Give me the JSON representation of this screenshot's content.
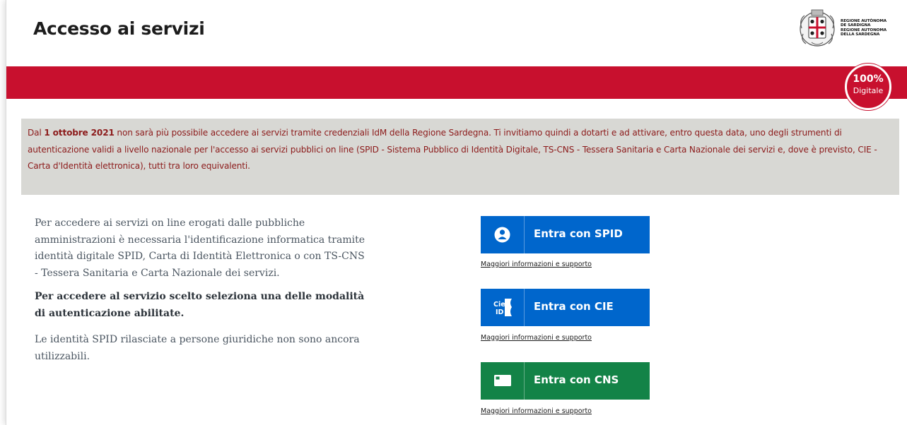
{
  "header": {
    "title": "Accesso ai servizi",
    "logo_lines": [
      "REGIONE AUTÒNOMA",
      "DE SARDIGNA",
      "REGIONE AUTONOMA",
      "DELLA SARDEGNA"
    ]
  },
  "badge": {
    "percent": "100%",
    "word": "Digitale"
  },
  "notice": {
    "before_date": "Dal ",
    "date": "1 ottobre 2021",
    "after_date": " non sarà più possibile accedere ai servizi tramite credenziali IdM della Regione Sardegna. Ti invitiamo quindi a dotarti e ad attivare, entro questa data, uno degli strumenti di autenticazione validi a livello nazionale per l'accesso ai servizi pubblici on line (SPID - Sistema Pubblico di Identità Digitale, TS-CNS - Tessera Sanitaria e Carta Nazionale dei servizi e, dove è previsto, CIE - Carta d'Identità elettronica), tutti tra loro equivalenti."
  },
  "info": {
    "p1": "Per accedere ai servizi on line erogati dalle pubbliche amministrazioni è necessaria l'identificazione informatica tramite identità digitale SPID, Carta di Identità Elettronica o con TS-CNS - Tessera Sanitaria e Carta Nazionale dei servizi.",
    "p2": "Per accedere al servizio scelto seleziona una delle modalità di autenticazione abilitate.",
    "p3": "Le identità SPID rilasciate a persone giuridiche non sono ancora utilizzabili."
  },
  "login": {
    "spid": {
      "label": "Entra con SPID",
      "help": "Maggiori informazioni e supporto",
      "icon": "spid-user-icon"
    },
    "cie": {
      "label": "Entra con CIE",
      "help": "Maggiori informazioni e supporto",
      "icon": "cie-id-icon",
      "icon_text_top": "Cie",
      "icon_text_bottom": "ID"
    },
    "cns": {
      "label": "Entra con CNS",
      "help": "Maggiori informazioni e supporto",
      "icon": "smart-card-icon"
    }
  },
  "colors": {
    "red_bar": "#c8102e",
    "spid_blue": "#0066cc",
    "cns_green": "#138347",
    "notice_bg": "#d8d8d4",
    "notice_text": "#8c1b1b"
  }
}
